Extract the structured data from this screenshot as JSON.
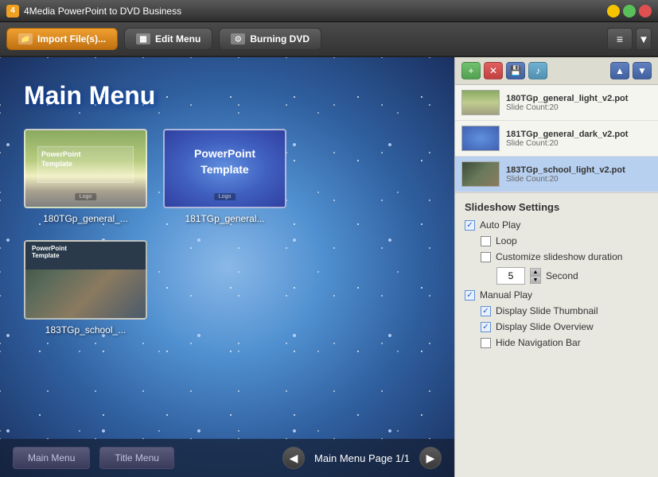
{
  "titleBar": {
    "title": "4Media PowerPoint to DVD Business",
    "icon": "4"
  },
  "toolbar": {
    "import_label": "Import File(s)...",
    "edit_menu_label": "Edit Menu",
    "burning_dvd_label": "Burning DVD"
  },
  "preview": {
    "menu_title": "Main Menu",
    "thumbnails": [
      {
        "name": "180TGp_general_...",
        "style": "tmpl1"
      },
      {
        "name": "181TGp_general...",
        "style": "tmpl2"
      },
      {
        "name": "183TGp_school_...",
        "style": "tmpl3"
      }
    ],
    "page_label": "Main Menu Page 1/1",
    "nav_prev": "◀",
    "nav_next": "▶",
    "main_menu_btn": "Main Menu",
    "title_menu_btn": "Title Menu"
  },
  "templateList": {
    "add_btn": "+",
    "remove_btn": "×",
    "save_btn": "💾",
    "music_btn": "♪",
    "up_btn": "▲",
    "down_btn": "▼",
    "items": [
      {
        "id": 1,
        "name": "180TGp_general_light_v2.pot",
        "count": "Slide Count:20",
        "selected": false
      },
      {
        "id": 2,
        "name": "181TGp_general_dark_v2.pot",
        "count": "Slide Count:20",
        "selected": false
      },
      {
        "id": 3,
        "name": "183TGp_school_light_v2.pot",
        "count": "Slide Count:20",
        "selected": true
      }
    ]
  },
  "settings": {
    "title": "Slideshow Settings",
    "auto_play_label": "Auto Play",
    "loop_label": "Loop",
    "customize_label": "Customize slideshow duration",
    "duration_value": "5",
    "second_label": "Second",
    "manual_play_label": "Manual Play",
    "display_thumbnail_label": "Display Slide Thumbnail",
    "display_overview_label": "Display Slide Overview",
    "hide_nav_label": "Hide Navigation Bar",
    "auto_play_checked": true,
    "loop_checked": false,
    "customize_checked": false,
    "manual_play_checked": true,
    "display_thumbnail_checked": true,
    "display_overview_checked": true,
    "hide_nav_checked": false
  }
}
